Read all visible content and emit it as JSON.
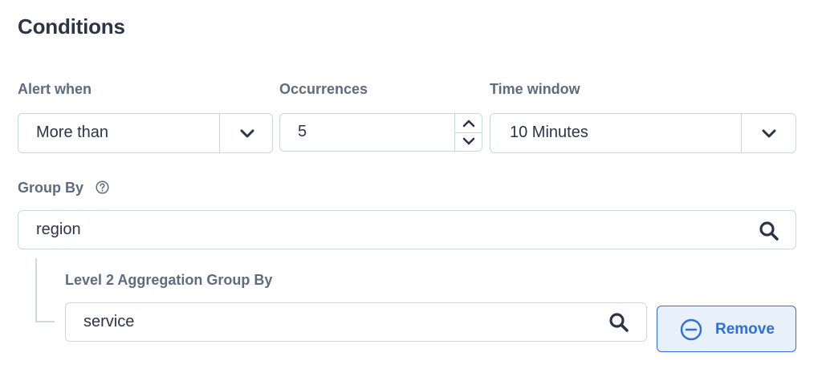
{
  "section": {
    "title": "Conditions"
  },
  "alert_when": {
    "label": "Alert when",
    "value": "More than"
  },
  "occurrences": {
    "label": "Occurrences",
    "value": "5"
  },
  "time_window": {
    "label": "Time window",
    "value": "10 Minutes"
  },
  "group_by": {
    "label": "Group By",
    "value": "region"
  },
  "level2": {
    "label": "Level 2 Aggregation Group By",
    "value": "service"
  },
  "remove_button": {
    "label": "Remove"
  },
  "icons": {
    "dropdown": "chevron-down-icon",
    "spinner_up": "chevron-up-icon",
    "spinner_down": "chevron-down-icon",
    "help": "help-circle-icon",
    "search": "search-icon",
    "remove": "minus-circle-icon"
  },
  "colors": {
    "accent": "#2f6fd6",
    "accent_bg": "#e8f0fc",
    "text": "#2b3448",
    "label": "#5f6b80",
    "border": "#cfd5df"
  }
}
